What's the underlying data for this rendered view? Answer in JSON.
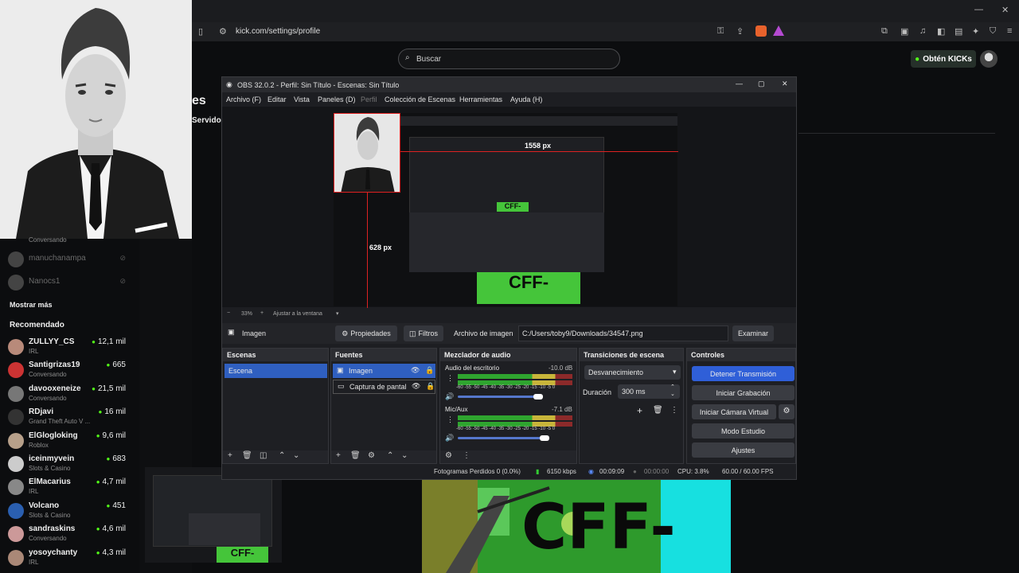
{
  "browser": {
    "url": "kick.com/settings/profile",
    "search_placeholder": "Buscar",
    "kicks_label": "Obtén KICKs"
  },
  "page_fragments": {
    "heading_partial": "es",
    "subheading_partial": "Servido"
  },
  "sidebar": {
    "followed": [
      {
        "name": "",
        "sub": "Conversando"
      },
      {
        "name": "manuchanampa",
        "sub": ""
      },
      {
        "name": "Nanocs1",
        "sub": ""
      }
    ],
    "show_more": "Mostrar más",
    "recommended_title": "Recomendado",
    "recommended": [
      {
        "name": "ZULLYY_CS",
        "sub": "IRL",
        "viewers": "12,1 mil",
        "color": "#b88a7a"
      },
      {
        "name": "Santigrizas19",
        "sub": "Conversando",
        "viewers": "665",
        "color": "#c33"
      },
      {
        "name": "davooxeneize",
        "sub": "Conversando",
        "viewers": "21,5 mil",
        "color": "#777"
      },
      {
        "name": "RDjavi",
        "sub": "Grand Theft Auto V ...",
        "viewers": "16 mil",
        "color": "#333"
      },
      {
        "name": "ElGlogloking",
        "sub": "Roblox",
        "viewers": "9,6 mil",
        "color": "#b7a08a"
      },
      {
        "name": "iceinmyvein",
        "sub": "Slots & Casino",
        "viewers": "683",
        "color": "#ccc"
      },
      {
        "name": "ElMacarius",
        "sub": "IRL",
        "viewers": "4,7 mil",
        "color": "#888"
      },
      {
        "name": "Volcano",
        "sub": "Slots & Casino",
        "viewers": "451",
        "color": "#2a5fb0"
      },
      {
        "name": "sandraskins",
        "sub": "Conversando",
        "viewers": "4,6 mil",
        "color": "#c99"
      },
      {
        "name": "yosoychanty",
        "sub": "IRL",
        "viewers": "4,3 mil",
        "color": "#a87"
      }
    ]
  },
  "obs": {
    "title": "OBS 32.0.2 - Perfil: Sin Título - Escenas: Sin Título",
    "menu": [
      "Archivo (F)",
      "Editar",
      "Vista",
      "Paneles (D)",
      "Perfil",
      "Colección de Escenas",
      "Herramientas",
      "Ayuda (H)"
    ],
    "preview": {
      "width_label": "1558 px",
      "height_label": "628 px",
      "zoom": "33%",
      "fit_label": "Ajustar a la ventana",
      "overlay_text": "CFF-"
    },
    "props": {
      "source_name": "Imagen",
      "properties_label": "Propiedades",
      "filters_label": "Filtros",
      "file_label": "Archivo de imagen",
      "file_path": "C:/Users/toby9/Downloads/34547.png",
      "browse_label": "Examinar"
    },
    "scenes": {
      "title": "Escenas",
      "items": [
        "Escena"
      ]
    },
    "sources": {
      "title": "Fuentes",
      "items": [
        "Imagen",
        "Captura de pantal"
      ]
    },
    "mixer": {
      "title": "Mezclador de audio",
      "channels": [
        {
          "name": "Audio del escritorio",
          "db": "-10.0 dB",
          "scale": "-60 -55 -50 -45 -40 -35 -30 -25 -20 -15 -10 -5 0",
          "level": 0.72
        },
        {
          "name": "Mic/Aux",
          "db": "-7.1 dB",
          "scale": "-60 -55 -50 -45 -40 -35 -30 -25 -20 -15 -10 -5 0",
          "level": 0.78
        }
      ]
    },
    "transitions": {
      "title": "Transiciones de escena",
      "selected": "Desvanecimiento",
      "duration_label": "Duración",
      "duration_value": "300 ms"
    },
    "controls": {
      "title": "Controles",
      "buttons": [
        "Detener Transmisión",
        "Iniciar Grabación",
        "Iniciar Cámara Virtual",
        "Modo Estudio",
        "Ajustes"
      ]
    },
    "status": {
      "dropped": "Fotogramas Perdidos 0 (0.0%)",
      "bitrate": "6150 kbps",
      "stream_time": "00:09:09",
      "rec_time": "00:00:00",
      "cpu": "CPU: 3.8%",
      "fps": "60.00 / 60.00 FPS"
    }
  },
  "stream_overlay": {
    "text": "CFF-"
  },
  "colors": {
    "kick_green": "#53fc18",
    "obs_selection": "#2f5fc0",
    "stop_button": "#2f5fd8"
  }
}
